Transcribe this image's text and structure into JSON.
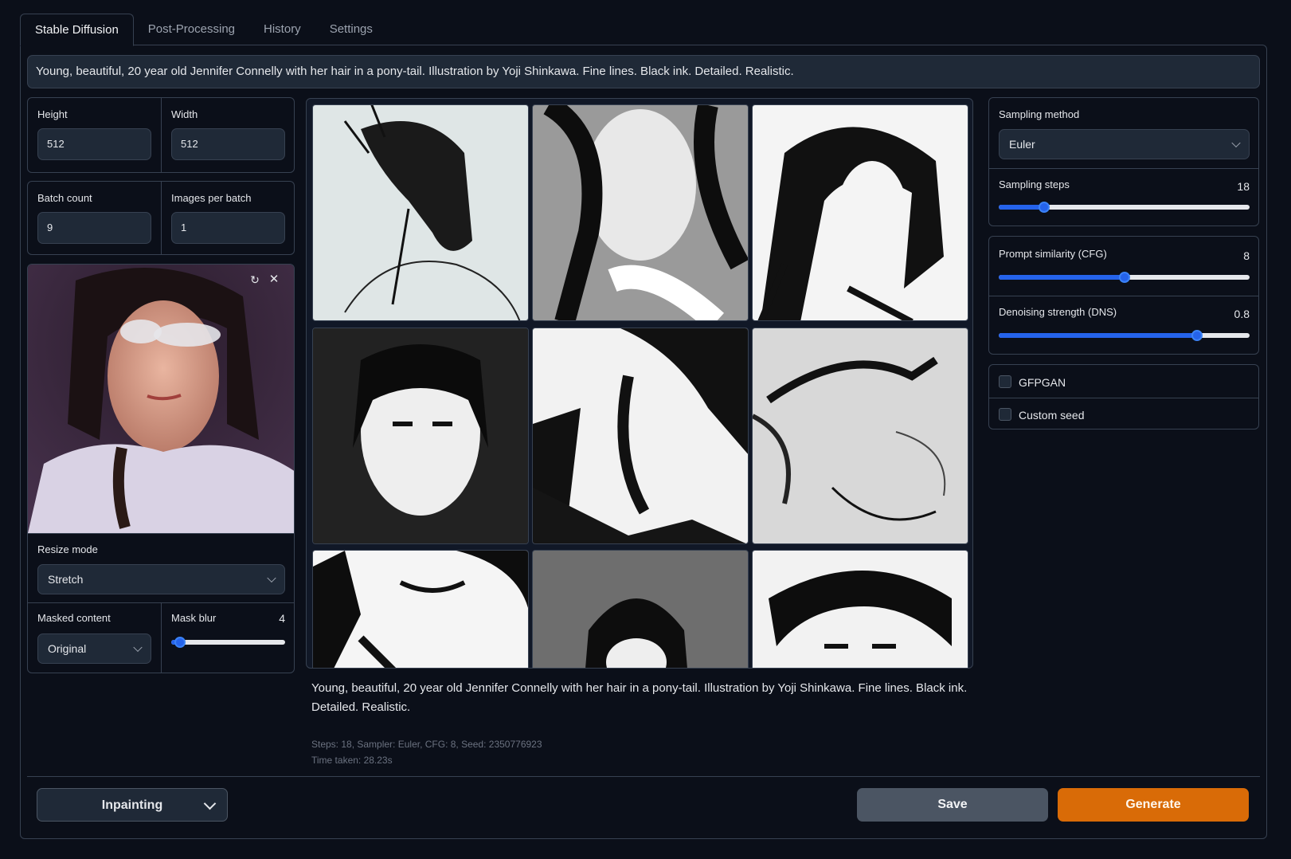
{
  "tabs": [
    "Stable Diffusion",
    "Post-Processing",
    "History",
    "Settings"
  ],
  "prompt": "Young, beautiful, 20 year old Jennifer Connelly with her hair in a pony-tail. Illustration by Yoji Shinkawa. Fine lines. Black ink. Detailed. Realistic.",
  "size": {
    "height_label": "Height",
    "height_value": "512",
    "width_label": "Width",
    "width_value": "512"
  },
  "batch": {
    "count_label": "Batch count",
    "count_value": "9",
    "per_batch_label": "Images per batch",
    "per_batch_value": "1"
  },
  "init_image": {
    "reset_icon": "refresh-icon",
    "close_icon": "close-icon"
  },
  "resize": {
    "label": "Resize mode",
    "value": "Stretch"
  },
  "masked": {
    "label": "Masked content",
    "value": "Original"
  },
  "mask_blur": {
    "label": "Mask blur",
    "value": "4",
    "fraction": 0.08
  },
  "sampling": {
    "method_label": "Sampling method",
    "method_value": "Euler",
    "steps_label": "Sampling steps",
    "steps_value": "18",
    "steps_fraction": 0.18
  },
  "cfg": {
    "label": "Prompt similarity (CFG)",
    "value": "8",
    "fraction": 0.5
  },
  "dns": {
    "label": "Denoising strength (DNS)",
    "value": "0.8",
    "fraction": 0.79
  },
  "options": {
    "gfpgan": "GFPGAN",
    "custom_seed": "Custom seed"
  },
  "output": {
    "caption": "Young, beautiful, 20 year old Jennifer Connelly with her hair in a pony-tail. Illustration by Yoji Shinkawa. Fine lines. Black ink. Detailed. Realistic.",
    "meta_line1": "Steps: 18, Sampler: Euler, CFG: 8, Seed: 2350776923",
    "meta_line2": "Time taken: 28.23s"
  },
  "buttons": {
    "mode": "Inpainting",
    "save": "Save",
    "generate": "Generate"
  },
  "colors": {
    "accent": "#2563eb",
    "generate": "#d96b07",
    "panel_bg": "#1f2937",
    "border": "#374151"
  }
}
